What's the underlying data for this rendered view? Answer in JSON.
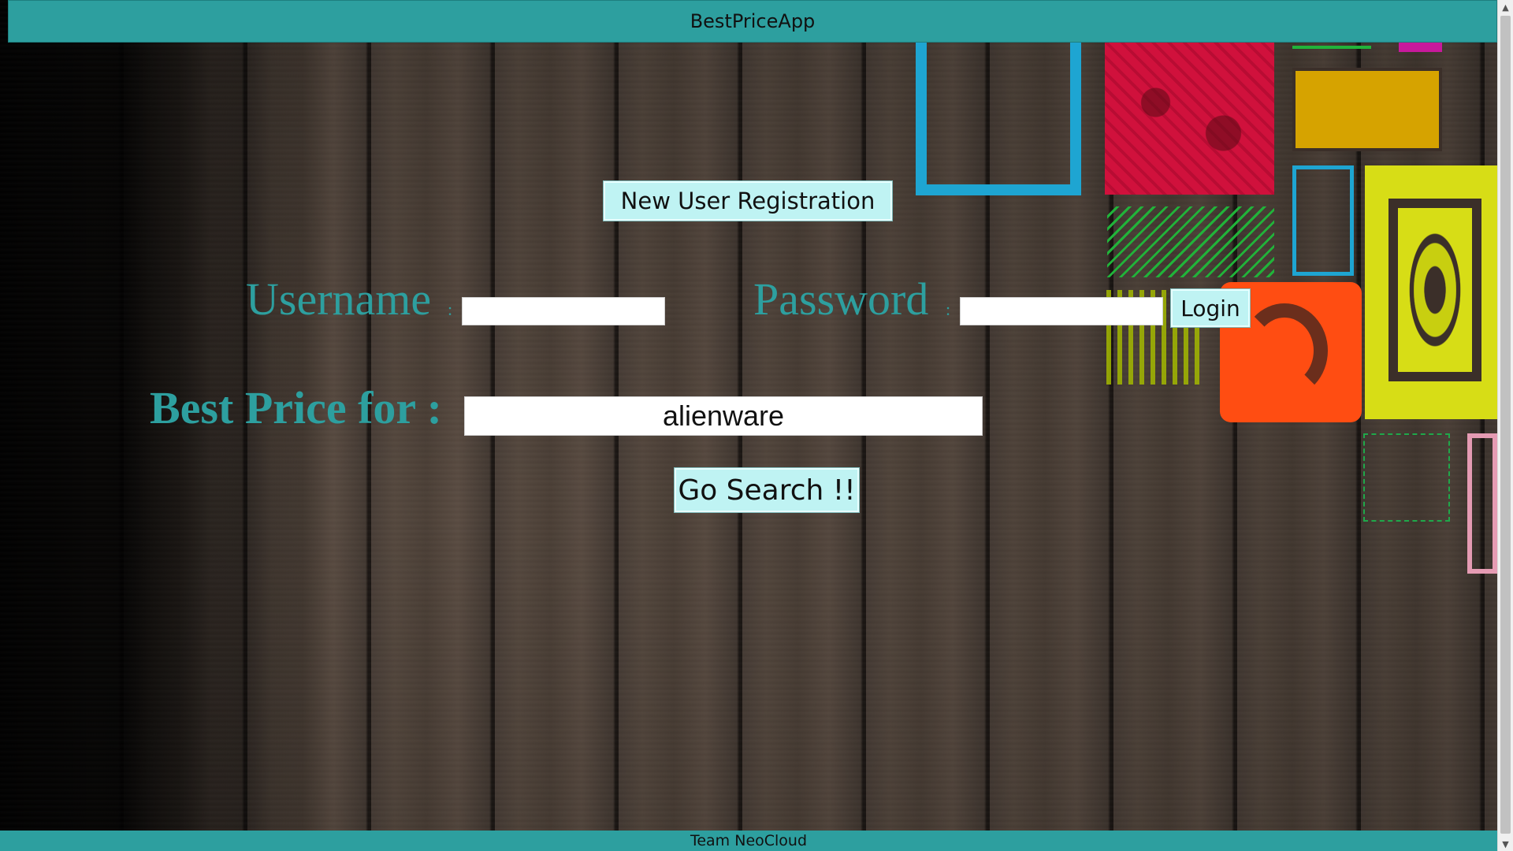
{
  "header": {
    "title": "BestPriceApp"
  },
  "footer": {
    "text": "Team NeoCloud"
  },
  "registration": {
    "button_label": "New User Registration"
  },
  "login": {
    "username_label": "Username",
    "username_colon": ":",
    "username_value": "",
    "password_label": "Password",
    "password_colon": ":",
    "password_value": "",
    "login_button": "Login"
  },
  "search": {
    "label": "Best Price for :",
    "value": "alienware",
    "button_label": "Go Search !!"
  },
  "scrollbar": {
    "up_icon": "▲",
    "down_icon": "▼"
  },
  "colors": {
    "bar_teal": "#2d9f9f",
    "button_bg": "#bff3f3",
    "label_teal": "#2d9f9f"
  }
}
